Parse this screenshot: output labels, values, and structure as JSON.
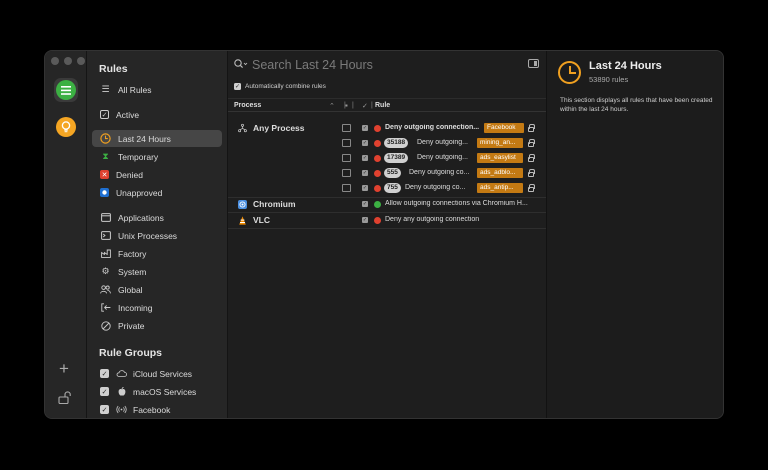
{
  "rail": {
    "plus": "+"
  },
  "sidebar": {
    "rules_heading": "Rules",
    "groups_heading": "Rule Groups",
    "items": [
      {
        "label": "All Rules"
      },
      {
        "label": "Active"
      },
      {
        "label": "Last 24 Hours"
      },
      {
        "label": "Temporary"
      },
      {
        "label": "Denied"
      },
      {
        "label": "Unapproved"
      },
      {
        "label": "Applications"
      },
      {
        "label": "Unix Processes"
      },
      {
        "label": "Factory"
      },
      {
        "label": "System"
      },
      {
        "label": "Global"
      },
      {
        "label": "Incoming"
      },
      {
        "label": "Private"
      }
    ],
    "groups": [
      {
        "label": "iCloud Services"
      },
      {
        "label": "macOS Services"
      },
      {
        "label": "Facebook"
      }
    ]
  },
  "search": {
    "placeholder": "Search Last 24 Hours"
  },
  "combine_label": "Automatically combine rules",
  "table": {
    "headers": {
      "process": "Process",
      "rule": "Rule"
    },
    "rows": [
      {
        "process": "Any Process",
        "rule": "Deny outgoing connection...",
        "tag": "Facebook",
        "count": ""
      },
      {
        "process": "",
        "rule": "Deny outgoing...",
        "tag": "mining_an...",
        "count": "35188"
      },
      {
        "process": "",
        "rule": "Deny outgoing...",
        "tag": "ads_easylist",
        "count": "17389"
      },
      {
        "process": "",
        "rule": "Deny outgoing co...",
        "tag": "ads_adblo...",
        "count": "555"
      },
      {
        "process": "",
        "rule": "Deny outgoing co...",
        "tag": "ads_antip...",
        "count": "755"
      },
      {
        "process": "Chromium",
        "rule": "Allow outgoing connections via Chromium H...",
        "tag": "",
        "count": ""
      },
      {
        "process": "VLC",
        "rule": "Deny any outgoing connection",
        "tag": "",
        "count": ""
      }
    ]
  },
  "detail": {
    "title": "Last 24 Hours",
    "subtitle": "53890 rules",
    "description": "This section displays all rules that have been created within the last 24 hours."
  },
  "colors": {
    "accent_green": "#3cb043",
    "accent_orange": "#f5a623",
    "tag_bg": "#c47a13",
    "deny_red": "#e0412f"
  }
}
